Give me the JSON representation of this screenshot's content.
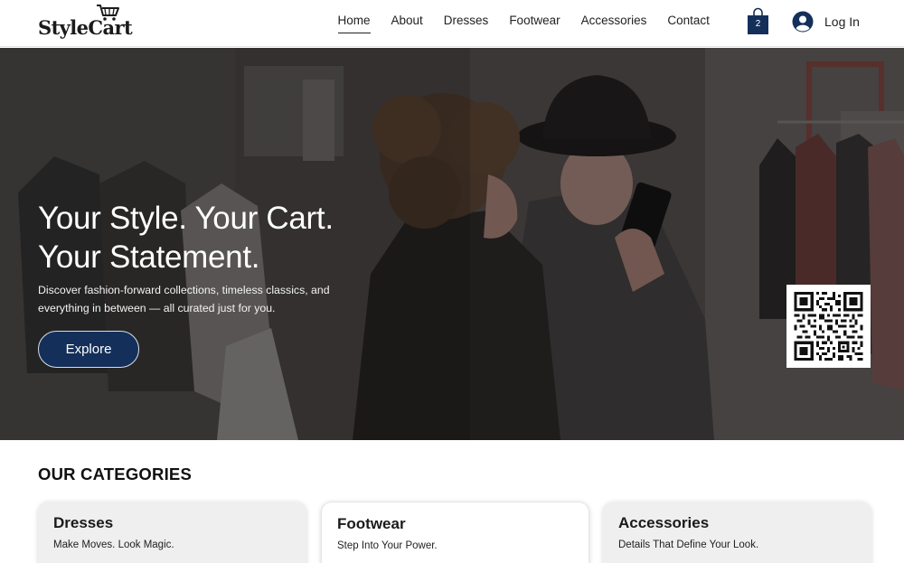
{
  "brand": {
    "name": "StyleCart"
  },
  "nav": {
    "items": [
      {
        "label": "Home",
        "active": true
      },
      {
        "label": "About"
      },
      {
        "label": "Dresses"
      },
      {
        "label": "Footwear"
      },
      {
        "label": "Accessories"
      },
      {
        "label": "Contact"
      }
    ]
  },
  "cart": {
    "count": "2",
    "icon": "shopping-bag-icon"
  },
  "account": {
    "login_label": "Log In",
    "icon": "user-avatar-icon"
  },
  "hero": {
    "title_line1": "Your Style. Your Cart.",
    "title_line2": "Your Statement.",
    "subtitle_line1": "Discover fashion-forward collections, timeless classics, and",
    "subtitle_line2": "everything in between — all curated just for you.",
    "cta_label": "Explore"
  },
  "categories": {
    "heading": "OUR CATEGORIES",
    "items": [
      {
        "title": "Dresses",
        "desc": "Make Moves. Look Magic."
      },
      {
        "title": "Footwear",
        "desc": "Step Into Your Power."
      },
      {
        "title": "Accessories",
        "desc": "Details That Define Your Look."
      }
    ]
  },
  "colors": {
    "brand_navy": "#14305a",
    "text_dark": "#222222",
    "card_grey": "#efefef"
  }
}
